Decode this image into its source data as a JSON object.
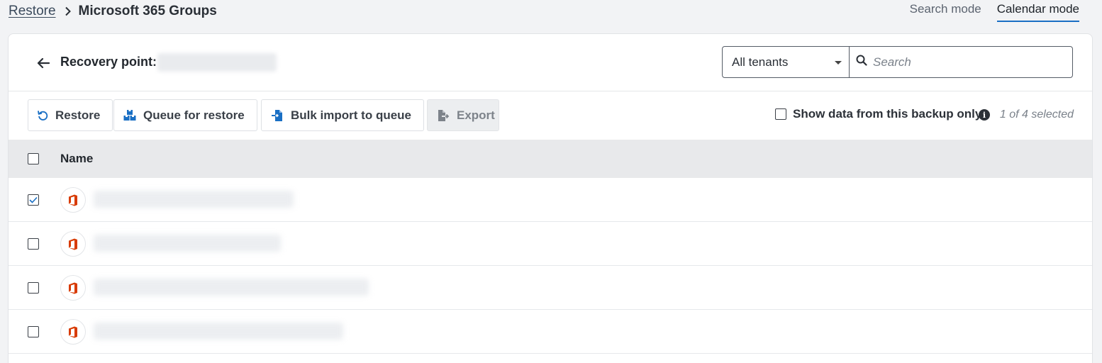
{
  "breadcrumb": {
    "parent": "Restore",
    "current": "Microsoft 365 Groups"
  },
  "modes": {
    "search": "Search mode",
    "calendar": "Calendar mode",
    "active": "Calendar mode"
  },
  "header": {
    "recovery_point_label": "Recovery point:",
    "recovery_point_value": "",
    "tenant_select_value": "All tenants",
    "search_placeholder": "Search"
  },
  "toolbar": {
    "restore_label": "Restore",
    "queue_label": "Queue for restore",
    "bulk_import_label": "Bulk import to queue",
    "export_label": "Export",
    "show_data_label": "Show data from this backup only",
    "show_data_checked": false,
    "selected_count": "1 of 4 selected"
  },
  "table": {
    "columns": [
      "Name"
    ],
    "rows": [
      {
        "name": "",
        "checked": true
      },
      {
        "name": "",
        "checked": false
      },
      {
        "name": "",
        "checked": false
      },
      {
        "name": "",
        "checked": false
      }
    ]
  },
  "colors": {
    "accent": "#1a6fc4",
    "office_icon": "#d83b01",
    "action_icon": "#1a6fc4"
  },
  "icons": {
    "crumb_separator": "chevron-right-icon",
    "back": "arrow-left-icon",
    "search": "search-icon",
    "restore": "undo-icon",
    "queue": "boxes-icon",
    "bulk_import": "file-import-icon",
    "export": "file-export-icon",
    "info": "info-icon",
    "row": "office-icon"
  }
}
